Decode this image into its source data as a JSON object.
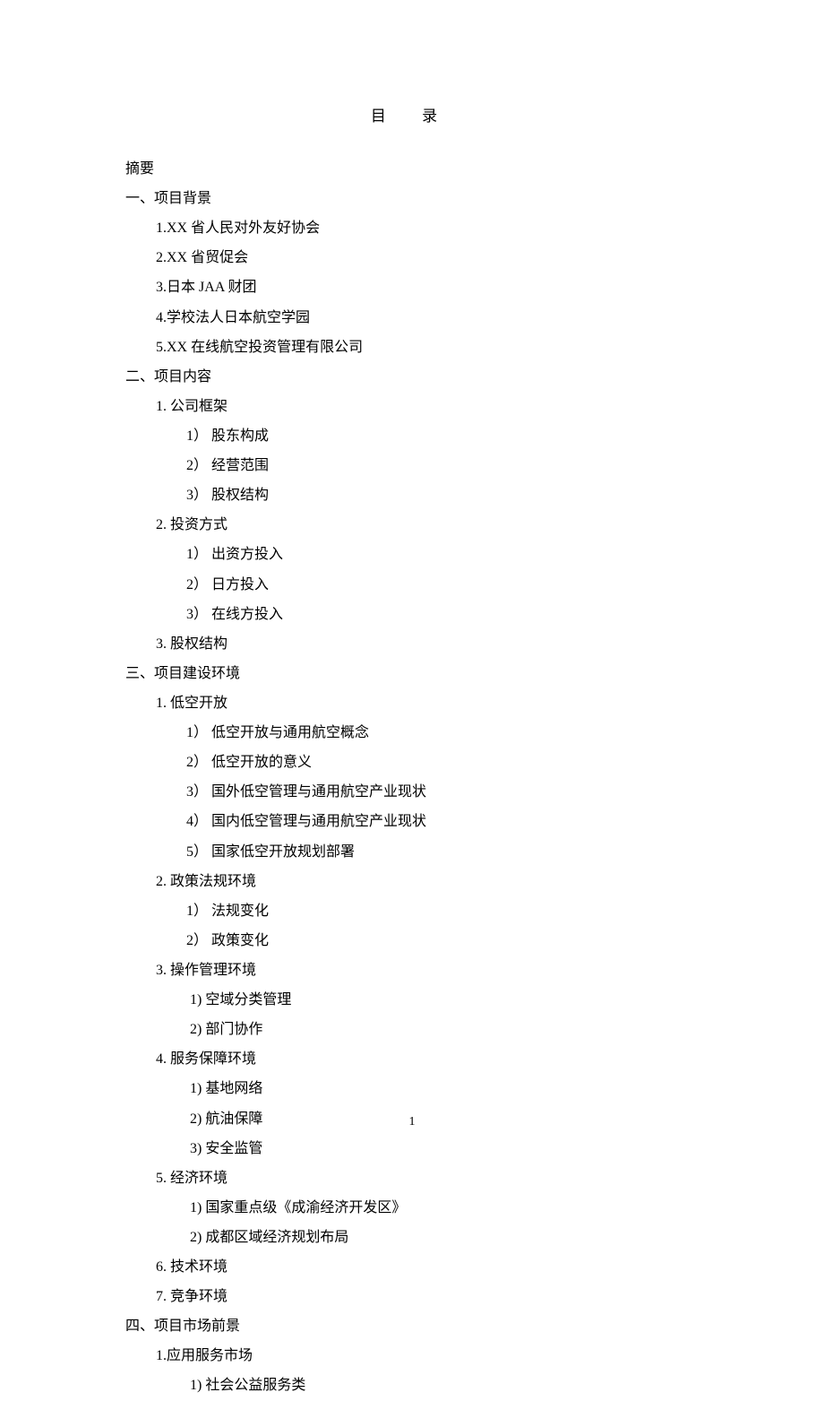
{
  "title": "目  录",
  "page_number": "1",
  "toc": {
    "abstract": "摘要",
    "s1": {
      "heading": "一、项目背景",
      "i1": "1.XX 省人民对外友好协会",
      "i2": "2.XX 省贸促会",
      "i3": "3.日本 JAA 财团",
      "i4": "4.学校法人日本航空学园",
      "i5": "5.XX 在线航空投资管理有限公司"
    },
    "s2": {
      "heading": "二、项目内容",
      "i1": {
        "h": "1. 公司框架",
        "a": "1） 股东构成",
        "b": "2） 经营范围",
        "c": "3） 股权结构"
      },
      "i2": {
        "h": "2. 投资方式",
        "a": "1） 出资方投入",
        "b": "2） 日方投入",
        "c": "3） 在线方投入"
      },
      "i3": "3. 股权结构"
    },
    "s3": {
      "heading": "三、项目建设环境",
      "i1": {
        "h": "1. 低空开放",
        "a": "1） 低空开放与通用航空概念",
        "b": "2） 低空开放的意义",
        "c": "3） 国外低空管理与通用航空产业现状",
        "d": "4） 国内低空管理与通用航空产业现状",
        "e": "5） 国家低空开放规划部署"
      },
      "i2": {
        "h": "2. 政策法规环境",
        "a": "1） 法规变化",
        "b": "2） 政策变化"
      },
      "i3": {
        "h": "3. 操作管理环境",
        "a": "1)   空域分类管理",
        "b": "2)   部门协作"
      },
      "i4": {
        "h": "4. 服务保障环境",
        "a": "1) 基地网络",
        "b": "2) 航油保障",
        "c": "3) 安全监管"
      },
      "i5": {
        "h": "5. 经济环境",
        "a": "1)   国家重点级《成渝经济开发区》",
        "b": "2)   成都区域经济规划布局"
      },
      "i6": "6. 技术环境",
      "i7": "7. 竞争环境"
    },
    "s4": {
      "heading": "四、项目市场前景",
      "i1": {
        "h": "1.应用服务市场",
        "a": "1)   社会公益服务类"
      }
    }
  }
}
